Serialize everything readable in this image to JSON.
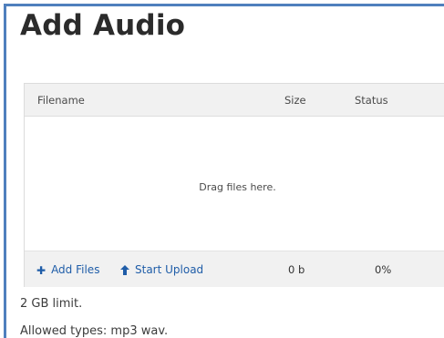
{
  "page": {
    "title": "Add Audio"
  },
  "uploader": {
    "columns": {
      "filename": "Filename",
      "size": "Size",
      "status": "Status"
    },
    "drop_text": "Drag files here.",
    "add_files_label": "Add Files",
    "start_upload_label": "Start Upload",
    "total_size": "0 b",
    "total_status": "0%",
    "icons": {
      "add_files": "plus-icon",
      "start_upload": "arrow-up-icon"
    }
  },
  "notes": {
    "limit": "2 GB limit.",
    "allowed_types": "Allowed types: mp3 wav."
  },
  "colors": {
    "frame_border": "#4f80bd",
    "link": "#1f5da8",
    "header_bg": "#f1f1f1"
  }
}
